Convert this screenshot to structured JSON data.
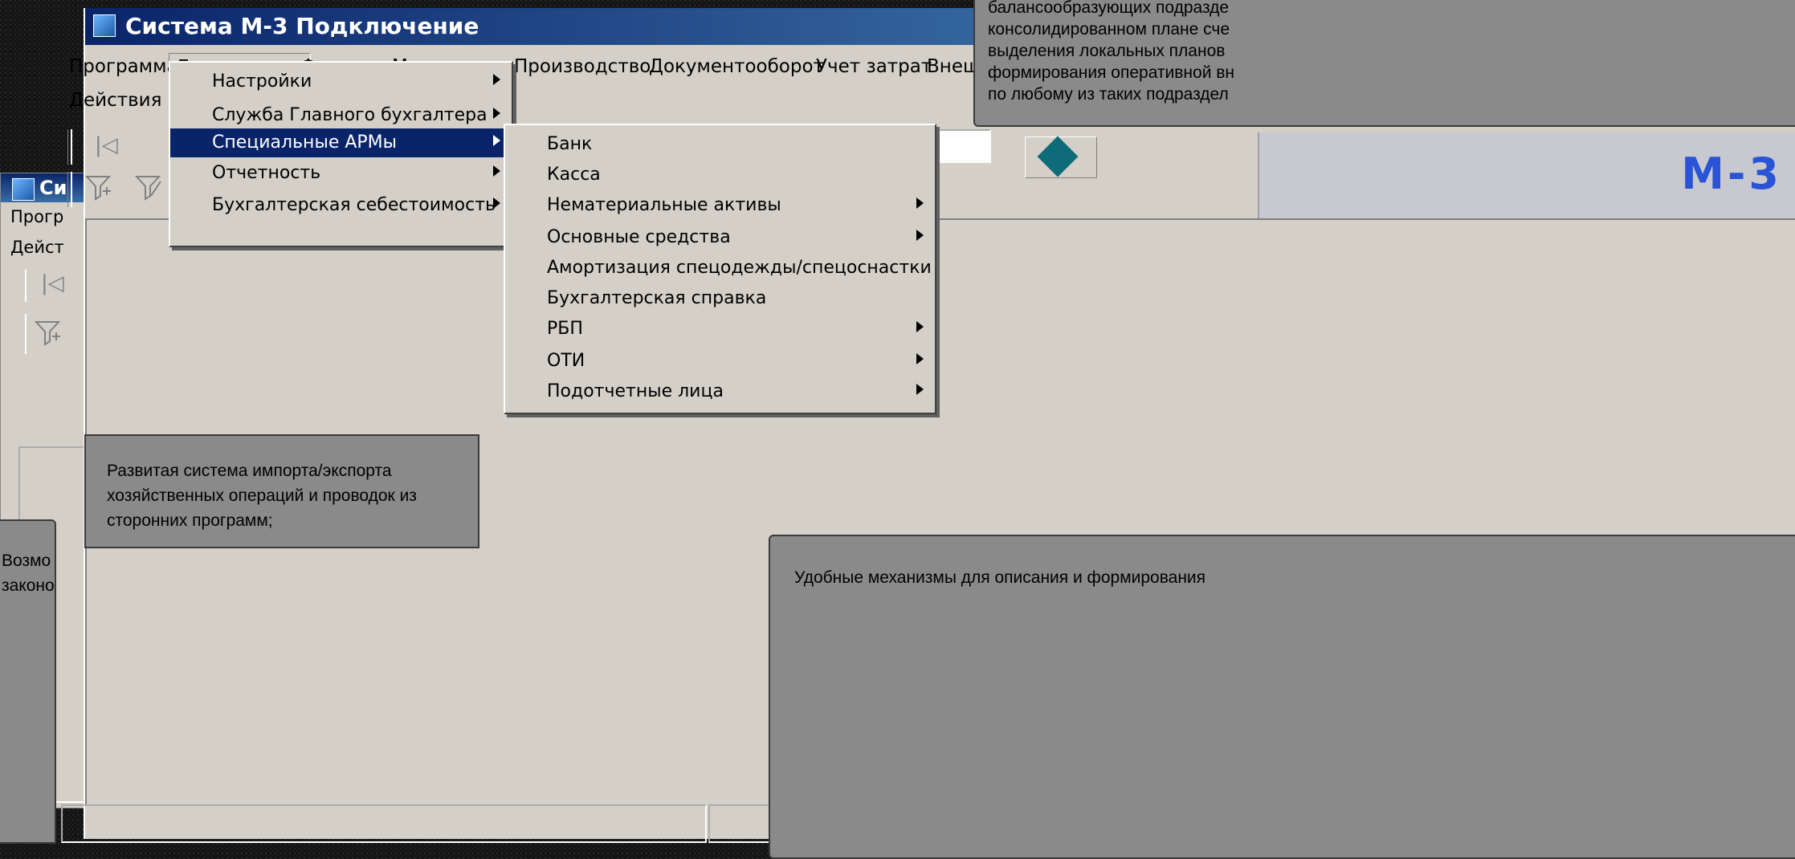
{
  "window": {
    "title": "Система М-3 Подключение",
    "logo_text": "М-3"
  },
  "back_window": {
    "title": "Си",
    "menu_row1": "Прогр",
    "menu_row2": "Дейст"
  },
  "menubar": {
    "items": [
      "Программа",
      "Бухгалтерия",
      "Финансы",
      "Мат. потоки",
      "Производство",
      "Документооборот",
      "Учет затрат",
      "Внешн"
    ],
    "active": "Бухгалтерия",
    "row2": "Действия"
  },
  "menu_buh": {
    "items": [
      {
        "label": "Настройки",
        "submenu": true
      },
      {
        "label": "Служба Главного бухгалтера",
        "submenu": true
      },
      {
        "label": "Специальные АРМы",
        "submenu": true,
        "selected": true
      },
      {
        "label": "Отчетность",
        "submenu": true
      },
      {
        "label": "Бухгалтерская себестоимость",
        "submenu": true
      }
    ]
  },
  "menu_arm": {
    "items": [
      {
        "label": "Банк",
        "submenu": false
      },
      {
        "label": "Касса",
        "submenu": false
      },
      {
        "label": "Нематериальные активы",
        "submenu": true
      },
      {
        "label": "Основные средства",
        "submenu": true
      },
      {
        "label": "Амортизация спецодежды/спецоснастки",
        "submenu": false
      },
      {
        "label": "Бухгалтерская справка",
        "submenu": false
      },
      {
        "label": "РБП",
        "submenu": true
      },
      {
        "label": "ОТИ",
        "submenu": true
      },
      {
        "label": "Подотчетные лица",
        "submenu": true
      }
    ]
  },
  "toolbar": {
    "icons": [
      "first-record-icon",
      "sum-icon",
      "tree-icon",
      "add-icon",
      "edit-icon",
      "remove-icon",
      "confirm-icon",
      "cancel-icon"
    ],
    "filter_icons": [
      "filter-add-icon",
      "filter-remove-icon"
    ]
  },
  "callouts": {
    "import_export": "Развитая система импорта/экспорта хозяйственных операций и проводок из сторонних программ;",
    "top_right": [
      "балансообразующих подразде",
      "консолидированном плане сче",
      "выделения локальных планов",
      "формирования оперативной вн",
      "по любому из таких подраздел"
    ],
    "bottom_right": "Удобные механизмы для описания и формирования",
    "bottom_left": [
      "Возмо",
      "законо"
    ]
  }
}
